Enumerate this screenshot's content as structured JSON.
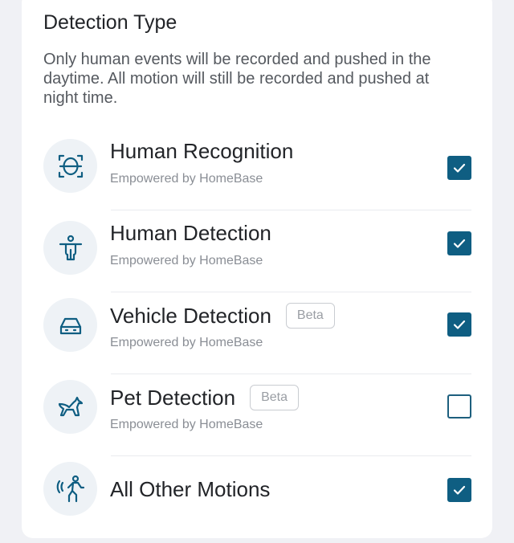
{
  "section": {
    "title": "Detection Type",
    "description": "Only human events will be recorded and pushed in the daytime. All motion will still be recorded and pushed at night time."
  },
  "items": [
    {
      "title": "Human Recognition",
      "subtitle": "Empowered by HomeBase",
      "badge": "",
      "checked": true,
      "icon": "face-scan-icon"
    },
    {
      "title": "Human Detection",
      "subtitle": "Empowered by HomeBase",
      "badge": "",
      "checked": true,
      "icon": "person-icon"
    },
    {
      "title": "Vehicle Detection",
      "subtitle": "Empowered by HomeBase",
      "badge": "Beta",
      "checked": true,
      "icon": "car-icon"
    },
    {
      "title": "Pet Detection",
      "subtitle": "Empowered by HomeBase",
      "badge": "Beta",
      "checked": false,
      "icon": "pet-icon"
    },
    {
      "title": "All Other Motions",
      "subtitle": "",
      "badge": "",
      "checked": true,
      "icon": "motion-icon"
    }
  ],
  "colors": {
    "accent": "#0f5e82",
    "icon": "#0f5e82",
    "icon_background": "#eef2f6"
  }
}
